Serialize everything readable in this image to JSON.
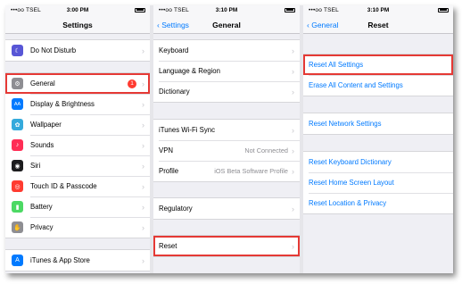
{
  "statusbar": {
    "p1": {
      "carrier": "•••oo TSEL",
      "time": "3:00 PM"
    },
    "p2": {
      "carrier": "•••oo TSEL",
      "time": "3:10 PM"
    },
    "p3": {
      "carrier": "•••oo TSEL",
      "time": "3:10 PM"
    }
  },
  "settings": {
    "title": "Settings",
    "items": [
      {
        "label": "Do Not Disturb",
        "icon": "moon-icon",
        "color": "#5856d6",
        "glyph": "☾"
      },
      {
        "label": "General",
        "icon": "gear-icon",
        "color": "#8e8e93",
        "glyph": "⚙",
        "badge": "1"
      },
      {
        "label": "Display & Brightness",
        "icon": "text-size-icon",
        "color": "#007aff",
        "glyph": "AA"
      },
      {
        "label": "Wallpaper",
        "icon": "flower-icon",
        "color": "#34aadc",
        "glyph": "✿"
      },
      {
        "label": "Sounds",
        "icon": "speaker-icon",
        "color": "#ff2d55",
        "glyph": "♪"
      },
      {
        "label": "Siri",
        "icon": "siri-icon",
        "color": "#1c1c1e",
        "glyph": "◉"
      },
      {
        "label": "Touch ID & Passcode",
        "icon": "fingerprint-icon",
        "color": "#ff3b30",
        "glyph": "◎"
      },
      {
        "label": "Battery",
        "icon": "battery-icon",
        "color": "#4cd964",
        "glyph": "▮"
      },
      {
        "label": "Privacy",
        "icon": "hand-icon",
        "color": "#8e8e93",
        "glyph": "✋"
      },
      {
        "label": "iTunes & App Store",
        "icon": "app-store-icon",
        "color": "#007aff",
        "glyph": "A"
      }
    ]
  },
  "general": {
    "back": "Settings",
    "title": "General",
    "items": [
      {
        "label": "Keyboard"
      },
      {
        "label": "Language & Region"
      },
      {
        "label": "Dictionary"
      },
      {
        "label": "iTunes Wi-Fi Sync"
      },
      {
        "label": "VPN",
        "value": "Not Connected"
      },
      {
        "label": "Profile",
        "value": "iOS Beta Software Profile"
      },
      {
        "label": "Regulatory"
      },
      {
        "label": "Reset"
      }
    ]
  },
  "reset": {
    "back": "General",
    "title": "Reset",
    "items": [
      {
        "label": "Reset All Settings"
      },
      {
        "label": "Erase All Content and Settings"
      },
      {
        "label": "Reset Network Settings"
      },
      {
        "label": "Reset Keyboard Dictionary"
      },
      {
        "label": "Reset Home Screen Layout"
      },
      {
        "label": "Reset Location & Privacy"
      }
    ]
  },
  "colors": {
    "highlight": "#e53935",
    "ios_blue": "#007aff",
    "badge": "#ff3b30"
  }
}
